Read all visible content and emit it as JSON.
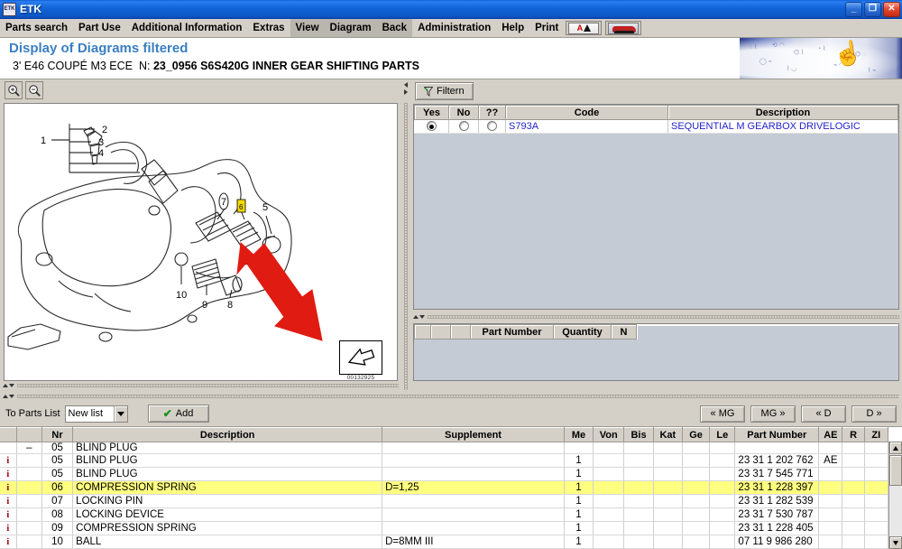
{
  "window": {
    "title": "ETK",
    "icon": "etk-app-icon",
    "buttons": {
      "minimize": "_",
      "restore": "❐",
      "close": "✕"
    }
  },
  "menubar": {
    "items": [
      {
        "label": "Parts search",
        "highlighted": false
      },
      {
        "label": "Part Use",
        "highlighted": false
      },
      {
        "label": "Additional Information",
        "highlighted": false
      },
      {
        "label": "Extras",
        "highlighted": false
      },
      {
        "label": "View",
        "highlighted": true
      },
      {
        "label": "Diagram",
        "highlighted": true
      },
      {
        "label": "Back",
        "highlighted": true
      },
      {
        "label": "Administration",
        "highlighted": false
      },
      {
        "label": "Help",
        "highlighted": false
      },
      {
        "label": "Print",
        "highlighted": false
      }
    ],
    "icon_buttons": [
      {
        "name": "warning-a-icon",
        "letter": "A"
      },
      {
        "name": "vehicle-icon",
        "letter": ""
      }
    ]
  },
  "header": {
    "title": "Display of Diagrams filtered",
    "model": "3' E46 COUPÉ M3 ECE",
    "nr_label": "N:",
    "nr_value": "23_0956 S6S420G INNER GEAR SHIFTING PARTS",
    "title_color": "#3a7fc1"
  },
  "diagram": {
    "zoom_in": "zoom-in",
    "zoom_out": "zoom-out",
    "reference_number": "00132925",
    "callouts": [
      "1",
      "2",
      "3",
      "4",
      "5",
      "7",
      "8",
      "9",
      "10"
    ],
    "highlight_marker": "red-arrow",
    "highlighted_item": "6"
  },
  "filter": {
    "button_label": "Filtern",
    "columns": [
      "Yes",
      "No",
      "??",
      "Code",
      "Description"
    ],
    "rows": [
      {
        "yes": true,
        "no": false,
        "unknown": false,
        "code": "S793A",
        "description": "SEQUENTIAL M GEARBOX DRIVELOGIC"
      }
    ]
  },
  "partnumber_panel": {
    "columns": [
      "",
      "",
      "",
      "Part Number",
      "Quantity",
      "N"
    ],
    "rows": []
  },
  "bottombar": {
    "to_parts_list_label": "To Parts List",
    "list_selected": "New list",
    "add_label": "Add",
    "nav_buttons": [
      "« MG",
      "MG »",
      "« D",
      "D »"
    ]
  },
  "parts_table": {
    "columns": [
      "",
      "",
      "Nr",
      "Description",
      "Supplement",
      "Me",
      "Von",
      "Bis",
      "Kat",
      "Ge",
      "Le",
      "Part Number",
      "AE",
      "R",
      "ZI"
    ],
    "rows": [
      {
        "info": "",
        "mark": "–",
        "nr": "05",
        "description": "BLIND PLUG",
        "supplement": "",
        "me": "",
        "von": "",
        "bis": "",
        "kat": "",
        "ge": "",
        "le": "",
        "part_number": "",
        "ae": "",
        "r": "",
        "zi": "",
        "selected": false,
        "clipped": true
      },
      {
        "info": "i",
        "mark": "",
        "nr": "05",
        "description": "BLIND PLUG",
        "supplement": "",
        "me": "1",
        "von": "",
        "bis": "",
        "kat": "",
        "ge": "",
        "le": "",
        "part_number": "23 31 1 202 762",
        "ae": "AE",
        "r": "",
        "zi": "",
        "selected": false,
        "clipped": false
      },
      {
        "info": "i",
        "mark": "",
        "nr": "05",
        "description": "BLIND PLUG",
        "supplement": "",
        "me": "1",
        "von": "",
        "bis": "",
        "kat": "",
        "ge": "",
        "le": "",
        "part_number": "23 31 7 545 771",
        "ae": "",
        "r": "",
        "zi": "",
        "selected": false,
        "clipped": false
      },
      {
        "info": "i",
        "mark": "",
        "nr": "06",
        "description": "COMPRESSION SPRING",
        "supplement": "D=1,25",
        "me": "1",
        "von": "",
        "bis": "",
        "kat": "",
        "ge": "",
        "le": "",
        "part_number": "23 31 1 228 397",
        "ae": "",
        "r": "",
        "zi": "",
        "selected": true,
        "clipped": false
      },
      {
        "info": "i",
        "mark": "",
        "nr": "07",
        "description": "LOCKING PIN",
        "supplement": "",
        "me": "1",
        "von": "",
        "bis": "",
        "kat": "",
        "ge": "",
        "le": "",
        "part_number": "23 31 1 282 539",
        "ae": "",
        "r": "",
        "zi": "",
        "selected": false,
        "clipped": false
      },
      {
        "info": "i",
        "mark": "",
        "nr": "08",
        "description": "LOCKING DEVICE",
        "supplement": "",
        "me": "1",
        "von": "",
        "bis": "",
        "kat": "",
        "ge": "",
        "le": "",
        "part_number": "23 31 7 530 787",
        "ae": "",
        "r": "",
        "zi": "",
        "selected": false,
        "clipped": false
      },
      {
        "info": "i",
        "mark": "",
        "nr": "09",
        "description": "COMPRESSION SPRING",
        "supplement": "",
        "me": "1",
        "von": "",
        "bis": "",
        "kat": "",
        "ge": "",
        "le": "",
        "part_number": "23 31 1 228 405",
        "ae": "",
        "r": "",
        "zi": "",
        "selected": false,
        "clipped": false
      },
      {
        "info": "i",
        "mark": "",
        "nr": "10",
        "description": "BALL",
        "supplement": "D=8MM III",
        "me": "1",
        "von": "",
        "bis": "",
        "kat": "",
        "ge": "",
        "le": "",
        "part_number": "07 11 9 986 280",
        "ae": "",
        "r": "",
        "zi": "",
        "selected": false,
        "clipped": false
      }
    ]
  },
  "colors": {
    "selection_yellow": "#ffff80",
    "link_blue": "#2222cc",
    "title_blue": "#3a7fc1",
    "chrome_gray": "#d4d0c8",
    "arrow_red": "#e01b12"
  }
}
